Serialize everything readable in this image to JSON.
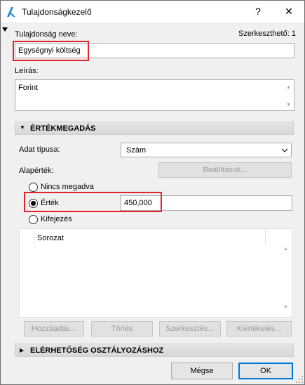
{
  "window": {
    "title": "Tulajdonságkezelő",
    "help_glyph": "?",
    "close_glyph": "✕"
  },
  "property": {
    "name_label": "Tulajdonság neve:",
    "editable_label": "Szerkeszthető: 1",
    "name_value": "Egységnyi költség",
    "description_label": "Leírás:",
    "description_value": "Forint"
  },
  "value_section": {
    "title": "ÉRTÉKMEGADÁS",
    "data_type_label": "Adat típusa:",
    "data_type_value": "Szám",
    "default_label": "Alapérték:",
    "settings_button": "Beállítások...",
    "options": [
      {
        "label": "Nincs megadva",
        "checked": false
      },
      {
        "label": "Érték",
        "checked": true
      },
      {
        "label": "Kifejezés",
        "checked": false
      }
    ],
    "value": "450,000",
    "list_header": "Sorozat",
    "buttons": {
      "add": "Hozzáadás...",
      "delete": "Törlés",
      "edit": "Szerkesztés...",
      "evaluate": "Kiértékelés..."
    }
  },
  "availability_section": {
    "title": "ELÉRHETŐSÉG OSZTÁLYOZÁSHOZ"
  },
  "footer": {
    "cancel": "Mégse",
    "ok": "OK"
  },
  "colors": {
    "highlight": "#e0242a",
    "accent": "#0078d7"
  }
}
